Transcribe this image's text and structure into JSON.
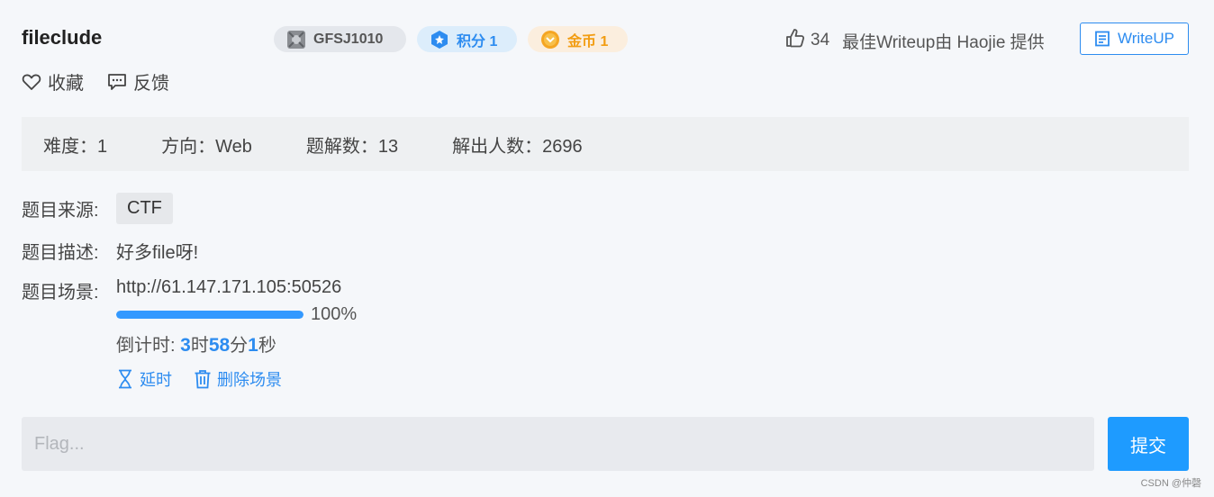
{
  "challenge": {
    "title": "fileclude",
    "id_badge": "GFSJ1010",
    "score_badge": "积分 1",
    "coin_badge": "金币 1"
  },
  "header": {
    "like_count": "34",
    "best_writeup_text": "最佳Writeup由 Haojie 提供",
    "writeup_button": "WriteUP"
  },
  "actions": {
    "favorite": "收藏",
    "feedback": "反馈"
  },
  "info": {
    "difficulty": "难度：1",
    "direction": "方向：Web",
    "solutions": "题解数：13",
    "solvers": "解出人数：2696"
  },
  "details": {
    "source_label": "题目来源:",
    "source_value": "CTF",
    "description_label": "题目描述:",
    "description_value": "好多file呀!",
    "scene_label": "题目场景:",
    "scene_url": "http://61.147.171.105:50526",
    "progress_percent": 100,
    "progress_text": "100%",
    "countdown_label": "倒计时: ",
    "countdown_hours": "3",
    "countdown_hours_unit": "时",
    "countdown_minutes": "58",
    "countdown_minutes_unit": "分",
    "countdown_seconds": "1",
    "countdown_seconds_unit": "秒",
    "extend_label": "延时",
    "delete_label": "删除场景"
  },
  "flag": {
    "placeholder": "Flag...",
    "submit_label": "提交"
  },
  "watermark": "CSDN @仲磬",
  "colors": {
    "accent": "#2d8cf0",
    "progress": "#3399ff",
    "submit": "#1e9bff",
    "coin": "#f29d12"
  },
  "icons": [
    "trophy-icon",
    "score-icon",
    "coin-icon",
    "thumbs-up-icon",
    "document-icon",
    "heart-icon",
    "comment-icon",
    "hourglass-icon",
    "trash-icon"
  ]
}
